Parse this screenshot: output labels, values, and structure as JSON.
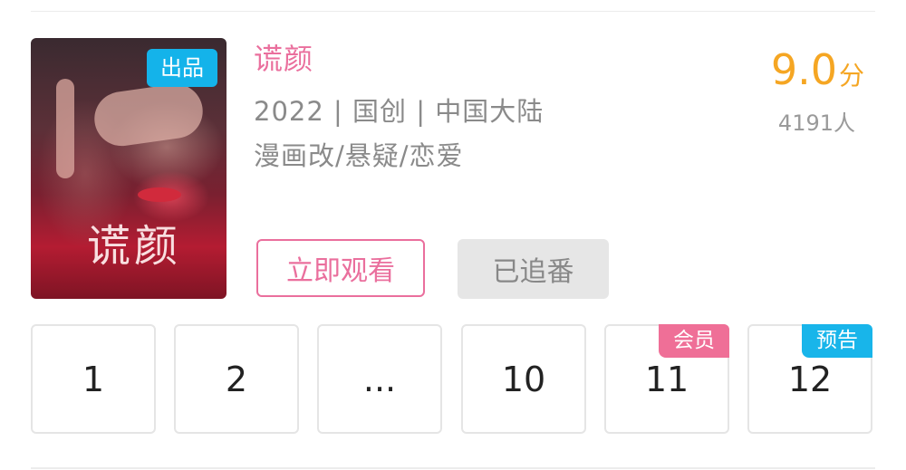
{
  "anime": {
    "title": "谎颜",
    "poster_badge": "出品",
    "poster_art_text": "谎颜",
    "meta_year_genre_region": "2022 | 国创 | 中国大陆",
    "meta_tags": "漫画改/悬疑/恋爱",
    "score": "9.0",
    "score_unit": "分",
    "rating_count": "4191人"
  },
  "actions": {
    "watch_label": "立即观看",
    "followed_label": "已追番"
  },
  "episodes": [
    {
      "label": "1",
      "badge": ""
    },
    {
      "label": "2",
      "badge": ""
    },
    {
      "label": "...",
      "badge": ""
    },
    {
      "label": "10",
      "badge": ""
    },
    {
      "label": "11",
      "badge": "会员"
    },
    {
      "label": "12",
      "badge": "预告"
    }
  ],
  "colors": {
    "title_pink": "#ea6f9d",
    "score_orange": "#f5a623",
    "badge_blue": "#14b3ea",
    "vip_pink": "#ef6f97"
  }
}
